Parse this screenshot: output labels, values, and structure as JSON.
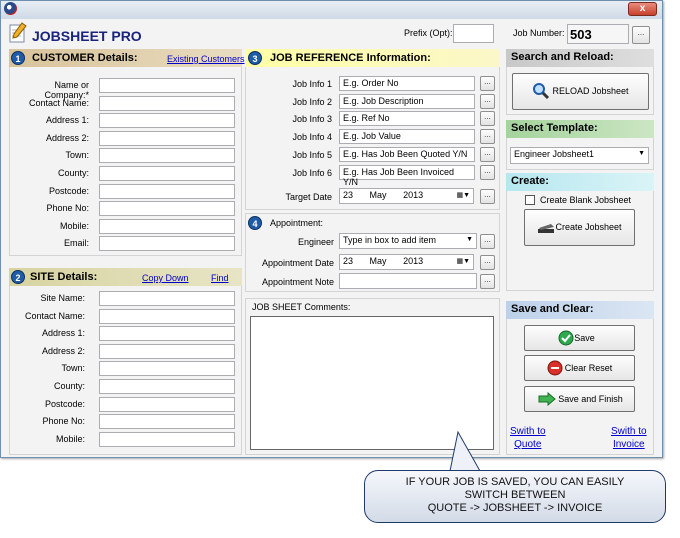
{
  "app": {
    "title": "JOBSHEET PRO",
    "close": "x"
  },
  "top": {
    "prefix_label": "Prefix (Opt):",
    "job_label": "Job Number:",
    "job_number": "503",
    "ellipsis": "..."
  },
  "customer": {
    "num": "1",
    "title": "CUSTOMER Details:",
    "link": "Existing Customers",
    "labels": [
      "Name or Company:*",
      "Contact Name:",
      "Address 1:",
      "Address 2:",
      "Town:",
      "County:",
      "Postcode:",
      "Phone No:",
      "Mobile:",
      "Email:"
    ]
  },
  "site": {
    "num": "2",
    "title": "SITE Details:",
    "link1": "Copy Down",
    "link2": "Find",
    "labels": [
      "Site Name:",
      "Contact Name:",
      "Address 1:",
      "Address 2:",
      "Town:",
      "County:",
      "Postcode:",
      "Phone No:",
      "Mobile:"
    ]
  },
  "jobref": {
    "num": "3",
    "title": "JOB REFERENCE Information:",
    "labels": [
      "Job Info 1",
      "Job Info 2",
      "Job Info 3",
      "Job Info 4",
      "Job Info 5",
      "Job Info 6",
      "Target Date"
    ],
    "values": [
      "E.g. Order No",
      "E.g. Job Description",
      "E.g. Ref No",
      "E.g. Job Value",
      "E.g.  Has Job Been Quoted Y/N",
      "E.g.  Has Job Been Invoiced Y/N"
    ],
    "target_date": {
      "day": "23",
      "month": "May",
      "year": "2013"
    }
  },
  "appointment": {
    "num": "4",
    "title": "Appointment:",
    "engineer_label": "Engineer",
    "engineer_value": "Type in box to add item",
    "date_label": "Appointment Date",
    "date": {
      "day": "23",
      "month": "May",
      "year": "2013"
    },
    "note_label": "Appointment Note"
  },
  "comments": {
    "title": "JOB SHEET Comments:"
  },
  "search": {
    "title": "Search and Reload:",
    "reload": "RELOAD Jobsheet"
  },
  "template": {
    "title": "Select Template:",
    "selected": "Engineer Jobsheet1"
  },
  "create": {
    "title": "Create:",
    "blank_label": "Create Blank Jobsheet",
    "button": "Create Jobsheet"
  },
  "save": {
    "title": "Save and Clear:",
    "save": "Save",
    "clear": "Clear Reset",
    "finish": "Save and Finish",
    "quote_link": [
      "Swith to",
      "Quote"
    ],
    "invoice_link": [
      "Swith to",
      "Invoice"
    ]
  },
  "callout": {
    "lines": [
      "IF YOUR JOB IS SAVED, YOU CAN EASILY",
      "SWITCH BETWEEN",
      "QUOTE -> JOBSHEET -> INVOICE"
    ]
  },
  "colors": {
    "title": "#1a237e",
    "num_badge": "#1f5ca8",
    "link": "#0000cc"
  }
}
